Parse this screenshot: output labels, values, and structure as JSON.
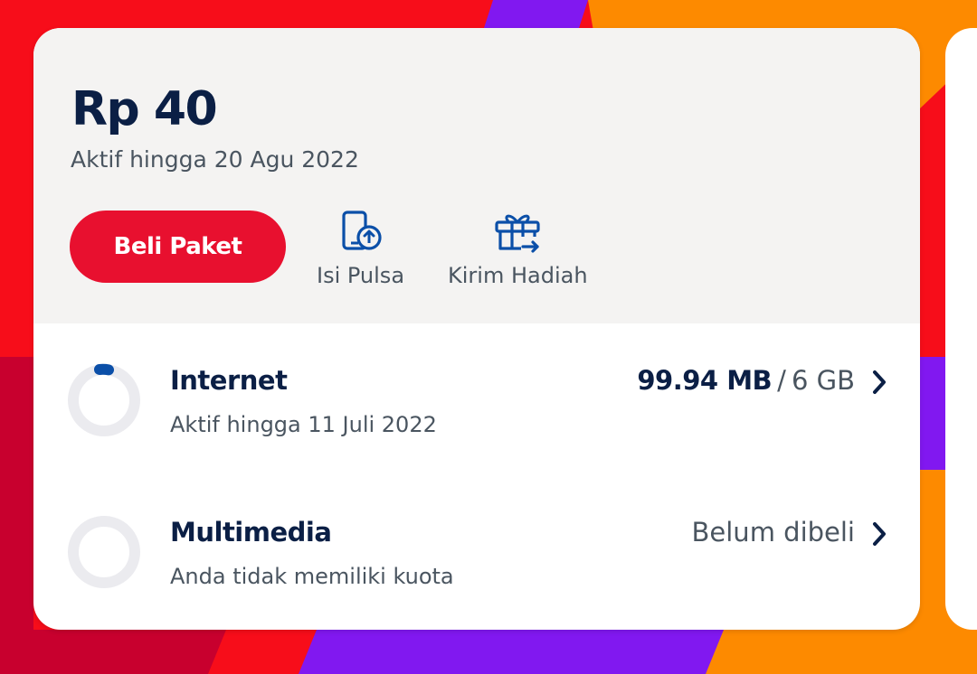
{
  "balance_card": {
    "balance": "Rp 40",
    "active_until": "Aktif hingga 20 Agu 2022",
    "buy_package_label": "Beli Paket",
    "actions": [
      {
        "label": "Isi Pulsa",
        "icon": "phone-topup-icon"
      },
      {
        "label": "Kirim Hadiah",
        "icon": "gift-send-icon"
      }
    ]
  },
  "quotas": [
    {
      "title": "Internet",
      "subtitle": "Aktif hingga 11 Juli 2022",
      "used": "99.94 MB",
      "separator": "/",
      "total": "6 GB",
      "progress_fraction": 0.02
    },
    {
      "title": "Multimedia",
      "subtitle": "Anda tidak memiliki kuota",
      "status": "Belum dibeli",
      "progress_fraction": 0
    }
  ],
  "colors": {
    "primary_red": "#e8102f",
    "navy": "#0b1f45",
    "accent_blue": "#0b4fa8",
    "ring_track": "#ebebef",
    "bg_red": "#f70d1a",
    "bg_orange": "#fd8a00",
    "bg_purple": "#8118f0"
  }
}
